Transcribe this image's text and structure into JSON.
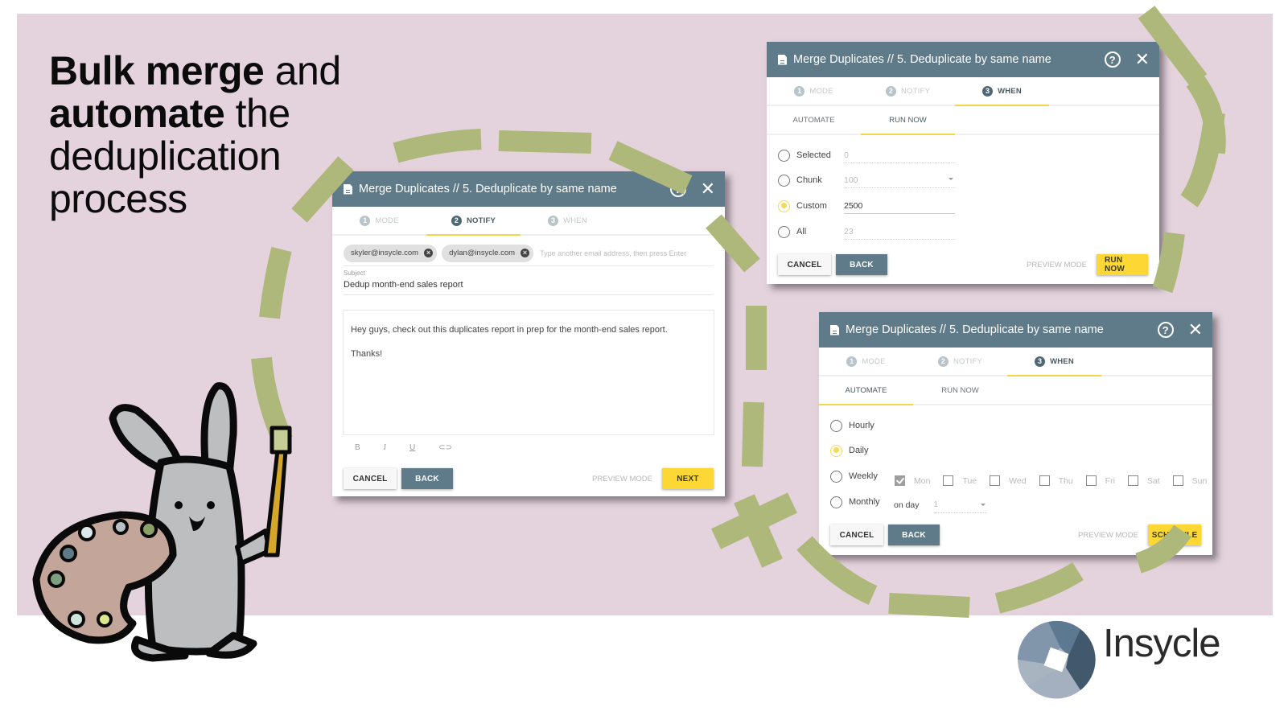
{
  "headline": {
    "line1_bold": "Bulk merge",
    "line1_rest": " and",
    "line2_bold": "automate",
    "line2_rest": " the",
    "line3": "deduplication",
    "line4": "process"
  },
  "colors": {
    "background_pink": "#e4d3dc",
    "dialog_header": "#5f7a88",
    "accent_yellow": "#fdd835",
    "brush_green": "#adb87a"
  },
  "dialogs": {
    "notify": {
      "title": "Merge Duplicates // 5. Deduplicate by same name",
      "steps": [
        {
          "num": "1",
          "label": "MODE"
        },
        {
          "num": "2",
          "label": "NOTIFY"
        },
        {
          "num": "3",
          "label": "WHEN"
        }
      ],
      "active_step": "NOTIFY",
      "recipients": [
        "skyler@insycle.com",
        "dylan@insycle.com"
      ],
      "recipient_placeholder": "Type another email address, then press Enter",
      "subject_label": "Subject",
      "subject_value": "Dedup month-end sales report",
      "body_line1": "Hey guys, check out this duplicates report in prep for the month-end sales report.",
      "body_line2": "Thanks!",
      "format": {
        "bold": "B",
        "italic": "I",
        "underline": "U",
        "link": "⊂⊃"
      },
      "cancel": "CANCEL",
      "back": "BACK",
      "preview": "PREVIEW MODE",
      "primary": "NEXT"
    },
    "run_now": {
      "title": "Merge Duplicates // 5. Deduplicate by same name",
      "steps": [
        {
          "num": "1",
          "label": "MODE"
        },
        {
          "num": "2",
          "label": "NOTIFY"
        },
        {
          "num": "3",
          "label": "WHEN"
        }
      ],
      "active_step": "WHEN",
      "subtabs": [
        "AUTOMATE",
        "RUN NOW"
      ],
      "active_subtab": "RUN NOW",
      "options": [
        {
          "label": "Selected",
          "value": "0",
          "selected": false
        },
        {
          "label": "Chunk",
          "value": "100",
          "selected": false,
          "dropdown": true
        },
        {
          "label": "Custom",
          "value": "2500",
          "selected": true
        },
        {
          "label": "All",
          "value": "23",
          "selected": false
        }
      ],
      "cancel": "CANCEL",
      "back": "BACK",
      "preview": "PREVIEW MODE",
      "primary": "RUN NOW"
    },
    "automate": {
      "title": "Merge Duplicates // 5. Deduplicate by same name",
      "steps": [
        {
          "num": "1",
          "label": "MODE"
        },
        {
          "num": "2",
          "label": "NOTIFY"
        },
        {
          "num": "3",
          "label": "WHEN"
        }
      ],
      "active_step": "WHEN",
      "subtabs": [
        "AUTOMATE",
        "RUN NOW"
      ],
      "active_subtab": "AUTOMATE",
      "frequencies": [
        {
          "label": "Hourly",
          "selected": false
        },
        {
          "label": "Daily",
          "selected": true
        },
        {
          "label": "Weekly",
          "selected": false
        },
        {
          "label": "Monthly",
          "selected": false
        }
      ],
      "days": [
        {
          "label": "Mon",
          "checked": true
        },
        {
          "label": "Tue",
          "checked": false
        },
        {
          "label": "Wed",
          "checked": false
        },
        {
          "label": "Thu",
          "checked": false
        },
        {
          "label": "Fri",
          "checked": false
        },
        {
          "label": "Sat",
          "checked": false
        },
        {
          "label": "Sun",
          "checked": false
        }
      ],
      "on_day_label": "on day",
      "on_day_value": "1",
      "cancel": "CANCEL",
      "back": "BACK",
      "preview": "PREVIEW MODE",
      "primary": "SCHEDULE"
    }
  },
  "logo": {
    "name": "Insycle"
  },
  "icons": {
    "doc": "document-icon",
    "help": "?",
    "close": "✕",
    "chip_remove": "×"
  }
}
